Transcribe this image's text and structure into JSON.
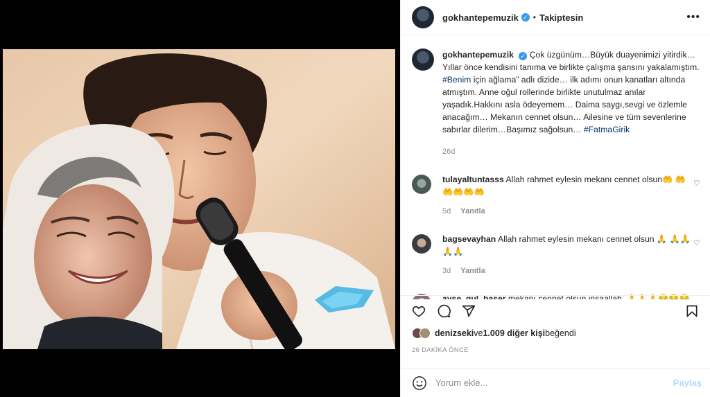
{
  "header": {
    "username": "gokhantepemuzik",
    "separator": "•",
    "follow_status": "Takiptesin",
    "more_icon": "more-horizontal-icon"
  },
  "caption": {
    "username": "gokhantepemuzik",
    "text_a": "Çok üzgünüm…Büyük duayenimizi yitirdik… Yıllar önce kendisini tanıma ve birlikte çalışma şansını yakalamıştım. ",
    "hashtag_1": "#Benim",
    "text_b": " için ağlama” adlı dizide… ilk adımı onun kanatları altında atmıştım. Anne oğul rollerinde birlikte unutulmaz anılar yaşadık.Hakkını asla ödeyemem… Daima saygı,sevgi ve özlemle anacağım… Mekanın cennet olsun… Ailesine ve tüm sevenlerine sabırlar dilerim…Başımız sağolsun… ",
    "hashtag_2": "#FatmaGirik",
    "age": "26d"
  },
  "comments": [
    {
      "username": "tulayaltuntasss",
      "text": "Allah rahmet eylesin mekanı cennet olsun🤲 🤲🤲🤲🤲🤲",
      "age": "5d",
      "reply": "Yanıtla"
    },
    {
      "username": "bagsevayhan",
      "text": "Allah rahmet eylesin mekanı cennet olsun 🙏 🙏🙏🙏🙏",
      "age": "3d",
      "reply": "Yanıtla"
    },
    {
      "username": "ayse_gul_baser",
      "text": "mekanı cennet olsun inşaallah. 🙏🙏🙏😔😔😔"
    }
  ],
  "likes": {
    "user": "denizseki",
    "connector": " ve ",
    "others": "1.009 diğer kişi",
    "suffix": " beğendi"
  },
  "timestamp": "26 DAKİKA ÖNCE",
  "add_comment": {
    "placeholder": "Yorum ekle...",
    "share_label": "Paylaş"
  },
  "colors": {
    "link": "#00376b",
    "verified": "#3897f0",
    "share_disabled": "#b3dbff",
    "muted": "#8e8e8e"
  }
}
